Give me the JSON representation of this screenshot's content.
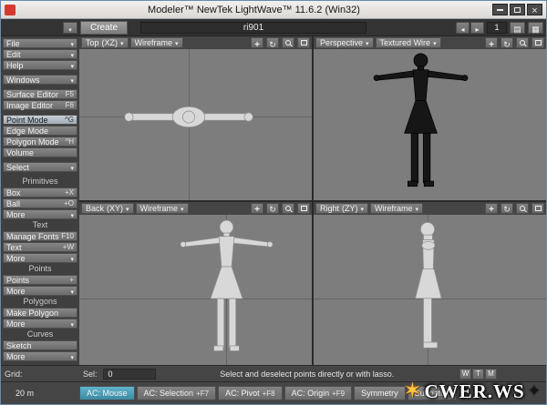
{
  "window": {
    "title": "Modeler™ NewTek LightWave™ 11.6.2 (Win32)"
  },
  "toolbar": {
    "tab_create": "Create",
    "object_name": "ri901",
    "layer": "1"
  },
  "sidebar": {
    "menus": [
      {
        "label": "File"
      },
      {
        "label": "Edit"
      },
      {
        "label": "Help"
      }
    ],
    "windows_label": "Windows",
    "editors": [
      {
        "label": "Surface Editor",
        "shortcut": "F5"
      },
      {
        "label": "Image Editor",
        "shortcut": "F6"
      }
    ],
    "modes": [
      {
        "label": "Point Mode",
        "shortcut": "^G"
      },
      {
        "label": "Edge Mode",
        "shortcut": ""
      },
      {
        "label": "Polygon Mode",
        "shortcut": "^H"
      },
      {
        "label": "Volume",
        "shortcut": ""
      }
    ],
    "select_label": "Select",
    "sections": [
      {
        "title": "Primitives",
        "items": [
          {
            "label": "Box",
            "shortcut": "+X"
          },
          {
            "label": "Ball",
            "shortcut": "+O"
          },
          {
            "label": "More",
            "shortcut": ""
          }
        ]
      },
      {
        "title": "Text",
        "items": [
          {
            "label": "Manage Fonts",
            "shortcut": "F10"
          },
          {
            "label": "Text",
            "shortcut": "+W"
          },
          {
            "label": "More",
            "shortcut": ""
          }
        ]
      },
      {
        "title": "Points",
        "items": [
          {
            "label": "Points",
            "shortcut": "+"
          },
          {
            "label": "More",
            "shortcut": ""
          }
        ]
      },
      {
        "title": "Polygons",
        "items": [
          {
            "label": "Make Polygon",
            "shortcut": ""
          },
          {
            "label": "More",
            "shortcut": ""
          }
        ]
      },
      {
        "title": "Curves",
        "items": [
          {
            "label": "Sketch",
            "shortcut": ""
          },
          {
            "label": "More",
            "shortcut": ""
          }
        ]
      }
    ]
  },
  "viewports": [
    {
      "view": "Top",
      "axis": "(XZ)",
      "mode": "Wireframe"
    },
    {
      "view": "Perspective",
      "axis": "",
      "mode": "Textured Wire"
    },
    {
      "view": "Back",
      "axis": "(XY)",
      "mode": "Wireframe"
    },
    {
      "view": "Right",
      "axis": "(ZY)",
      "mode": "Wireframe"
    }
  ],
  "status": {
    "grid_label": "Grid:",
    "grid_value": "20 m",
    "sel_label": "Sel:",
    "sel_value": "0",
    "hint": "Select and deselect points directly or with lasso.",
    "vmap": [
      "W",
      "T",
      "M"
    ]
  },
  "bottom_bar": {
    "items": [
      {
        "label": "AC: Mouse",
        "shortcut": ""
      },
      {
        "label": "AC: Selection",
        "shortcut": "+F7"
      },
      {
        "label": "AC: Pivot",
        "shortcut": "+F8"
      },
      {
        "label": "AC: Origin",
        "shortcut": "+F9"
      },
      {
        "label": "Symmetry",
        "shortcut": ""
      },
      {
        "label": "Subpatch",
        "shortcut": ""
      }
    ]
  },
  "watermark": {
    "text": "CWER.WS"
  },
  "colors": {
    "window_border": "#6a8bab",
    "titlebar_hi": "#f2f0ed",
    "titlebar_lo": "#dcd9d5",
    "ui_bg": "#3f3f3f",
    "button_hi": "#868686",
    "button_lo": "#6c6c6c",
    "active_mode_hi": "#c8cfd7",
    "active_mode_lo": "#a2acb8",
    "accent_active_hi": "#5fb4cc",
    "accent_active_lo": "#3d89a1",
    "viewport_bg": "#7d7d7d",
    "grid_line": "#646464",
    "model_light": "#d8d8d8",
    "model_dark": "#161616",
    "logo_red": "#d23a2e",
    "watermark_star": "#ffc83d"
  }
}
